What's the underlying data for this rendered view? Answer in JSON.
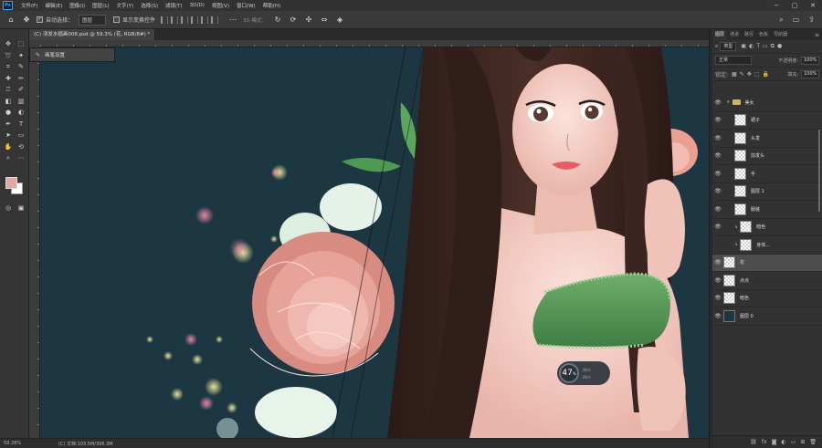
{
  "app": {
    "logo": "Ps",
    "menus": [
      "文件(F)",
      "编辑(E)",
      "图像(I)",
      "图层(L)",
      "文字(Y)",
      "选择(S)",
      "滤镜(T)",
      "3D(D)",
      "视图(V)",
      "窗口(W)",
      "帮助(H)"
    ],
    "window_controls": [
      "−",
      "▢",
      "✕"
    ]
  },
  "options": {
    "auto_select_label": "自动选择：",
    "auto_select_value": "图层",
    "show_transform_label": "显示变换控件",
    "mode_label": "3D 模式："
  },
  "document": {
    "tab_title": "(C) 浇发水插画008.psd @ 59.3% (花, RGB/8#) *"
  },
  "brush_popup": {
    "label": "画笔设置"
  },
  "gauge": {
    "value": "47",
    "unit": "%",
    "mark_top": "0K/s",
    "mark_bottom": "0K/s"
  },
  "status": {
    "zoom": "59.28%",
    "info": "(C) 文档:103.5M/396.3M"
  },
  "colors": {
    "foreground": "#e7a7a0",
    "background": "#ffffff",
    "canvas_bg": "#1c3642"
  },
  "layers_panel": {
    "tabs": [
      "图层",
      "通道",
      "路径",
      "色板",
      "导航器"
    ],
    "filter_type": "类型",
    "blend_mode": "正常",
    "opacity_label": "不透明度:",
    "opacity_value": "100%",
    "lock_label": "锁定:",
    "fill_label": "填充:",
    "fill_value": "100%",
    "layers": [
      {
        "name": "美女",
        "kind": "group"
      },
      {
        "name": "裙子",
        "kind": "layer"
      },
      {
        "name": "头发",
        "kind": "layer"
      },
      {
        "name": "前发头",
        "kind": "layer"
      },
      {
        "name": "手",
        "kind": "layer"
      },
      {
        "name": "图层 1",
        "kind": "layer"
      },
      {
        "name": "服装",
        "kind": "layer"
      },
      {
        "name": "暗色",
        "kind": "clip"
      },
      {
        "name": "身体...",
        "kind": "clip"
      },
      {
        "name": "花",
        "kind": "layer",
        "selected": true
      },
      {
        "name": "点点",
        "kind": "layer"
      },
      {
        "name": "暗色",
        "kind": "layer"
      },
      {
        "name": "图层 0",
        "kind": "bg"
      }
    ]
  }
}
